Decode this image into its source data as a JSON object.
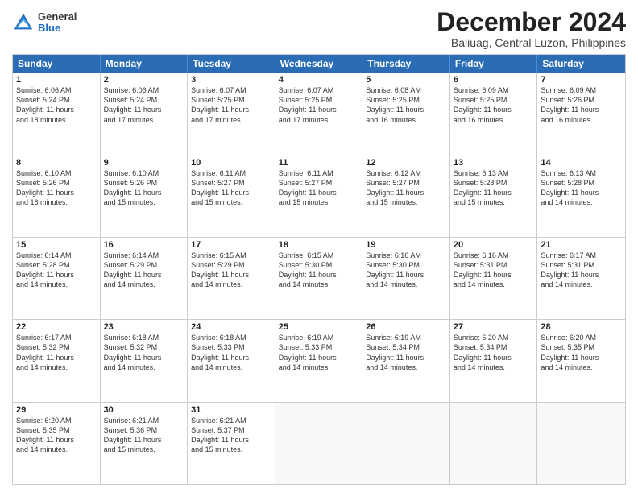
{
  "logo": {
    "general": "General",
    "blue": "Blue"
  },
  "title": {
    "month": "December 2024",
    "location": "Baliuag, Central Luzon, Philippines"
  },
  "header_days": [
    "Sunday",
    "Monday",
    "Tuesday",
    "Wednesday",
    "Thursday",
    "Friday",
    "Saturday"
  ],
  "rows": [
    [
      {
        "day": "1",
        "lines": [
          "Sunrise: 6:06 AM",
          "Sunset: 5:24 PM",
          "Daylight: 11 hours",
          "and 18 minutes."
        ]
      },
      {
        "day": "2",
        "lines": [
          "Sunrise: 6:06 AM",
          "Sunset: 5:24 PM",
          "Daylight: 11 hours",
          "and 17 minutes."
        ]
      },
      {
        "day": "3",
        "lines": [
          "Sunrise: 6:07 AM",
          "Sunset: 5:25 PM",
          "Daylight: 11 hours",
          "and 17 minutes."
        ]
      },
      {
        "day": "4",
        "lines": [
          "Sunrise: 6:07 AM",
          "Sunset: 5:25 PM",
          "Daylight: 11 hours",
          "and 17 minutes."
        ]
      },
      {
        "day": "5",
        "lines": [
          "Sunrise: 6:08 AM",
          "Sunset: 5:25 PM",
          "Daylight: 11 hours",
          "and 16 minutes."
        ]
      },
      {
        "day": "6",
        "lines": [
          "Sunrise: 6:09 AM",
          "Sunset: 5:25 PM",
          "Daylight: 11 hours",
          "and 16 minutes."
        ]
      },
      {
        "day": "7",
        "lines": [
          "Sunrise: 6:09 AM",
          "Sunset: 5:26 PM",
          "Daylight: 11 hours",
          "and 16 minutes."
        ]
      }
    ],
    [
      {
        "day": "8",
        "lines": [
          "Sunrise: 6:10 AM",
          "Sunset: 5:26 PM",
          "Daylight: 11 hours",
          "and 16 minutes."
        ]
      },
      {
        "day": "9",
        "lines": [
          "Sunrise: 6:10 AM",
          "Sunset: 5:26 PM",
          "Daylight: 11 hours",
          "and 15 minutes."
        ]
      },
      {
        "day": "10",
        "lines": [
          "Sunrise: 6:11 AM",
          "Sunset: 5:27 PM",
          "Daylight: 11 hours",
          "and 15 minutes."
        ]
      },
      {
        "day": "11",
        "lines": [
          "Sunrise: 6:11 AM",
          "Sunset: 5:27 PM",
          "Daylight: 11 hours",
          "and 15 minutes."
        ]
      },
      {
        "day": "12",
        "lines": [
          "Sunrise: 6:12 AM",
          "Sunset: 5:27 PM",
          "Daylight: 11 hours",
          "and 15 minutes."
        ]
      },
      {
        "day": "13",
        "lines": [
          "Sunrise: 6:13 AM",
          "Sunset: 5:28 PM",
          "Daylight: 11 hours",
          "and 15 minutes."
        ]
      },
      {
        "day": "14",
        "lines": [
          "Sunrise: 6:13 AM",
          "Sunset: 5:28 PM",
          "Daylight: 11 hours",
          "and 14 minutes."
        ]
      }
    ],
    [
      {
        "day": "15",
        "lines": [
          "Sunrise: 6:14 AM",
          "Sunset: 5:28 PM",
          "Daylight: 11 hours",
          "and 14 minutes."
        ]
      },
      {
        "day": "16",
        "lines": [
          "Sunrise: 6:14 AM",
          "Sunset: 5:29 PM",
          "Daylight: 11 hours",
          "and 14 minutes."
        ]
      },
      {
        "day": "17",
        "lines": [
          "Sunrise: 6:15 AM",
          "Sunset: 5:29 PM",
          "Daylight: 11 hours",
          "and 14 minutes."
        ]
      },
      {
        "day": "18",
        "lines": [
          "Sunrise: 6:15 AM",
          "Sunset: 5:30 PM",
          "Daylight: 11 hours",
          "and 14 minutes."
        ]
      },
      {
        "day": "19",
        "lines": [
          "Sunrise: 6:16 AM",
          "Sunset: 5:30 PM",
          "Daylight: 11 hours",
          "and 14 minutes."
        ]
      },
      {
        "day": "20",
        "lines": [
          "Sunrise: 6:16 AM",
          "Sunset: 5:31 PM",
          "Daylight: 11 hours",
          "and 14 minutes."
        ]
      },
      {
        "day": "21",
        "lines": [
          "Sunrise: 6:17 AM",
          "Sunset: 5:31 PM",
          "Daylight: 11 hours",
          "and 14 minutes."
        ]
      }
    ],
    [
      {
        "day": "22",
        "lines": [
          "Sunrise: 6:17 AM",
          "Sunset: 5:32 PM",
          "Daylight: 11 hours",
          "and 14 minutes."
        ]
      },
      {
        "day": "23",
        "lines": [
          "Sunrise: 6:18 AM",
          "Sunset: 5:32 PM",
          "Daylight: 11 hours",
          "and 14 minutes."
        ]
      },
      {
        "day": "24",
        "lines": [
          "Sunrise: 6:18 AM",
          "Sunset: 5:33 PM",
          "Daylight: 11 hours",
          "and 14 minutes."
        ]
      },
      {
        "day": "25",
        "lines": [
          "Sunrise: 6:19 AM",
          "Sunset: 5:33 PM",
          "Daylight: 11 hours",
          "and 14 minutes."
        ]
      },
      {
        "day": "26",
        "lines": [
          "Sunrise: 6:19 AM",
          "Sunset: 5:34 PM",
          "Daylight: 11 hours",
          "and 14 minutes."
        ]
      },
      {
        "day": "27",
        "lines": [
          "Sunrise: 6:20 AM",
          "Sunset: 5:34 PM",
          "Daylight: 11 hours",
          "and 14 minutes."
        ]
      },
      {
        "day": "28",
        "lines": [
          "Sunrise: 6:20 AM",
          "Sunset: 5:35 PM",
          "Daylight: 11 hours",
          "and 14 minutes."
        ]
      }
    ],
    [
      {
        "day": "29",
        "lines": [
          "Sunrise: 6:20 AM",
          "Sunset: 5:35 PM",
          "Daylight: 11 hours",
          "and 14 minutes."
        ]
      },
      {
        "day": "30",
        "lines": [
          "Sunrise: 6:21 AM",
          "Sunset: 5:36 PM",
          "Daylight: 11 hours",
          "and 15 minutes."
        ]
      },
      {
        "day": "31",
        "lines": [
          "Sunrise: 6:21 AM",
          "Sunset: 5:37 PM",
          "Daylight: 11 hours",
          "and 15 minutes."
        ]
      },
      {
        "day": "",
        "lines": []
      },
      {
        "day": "",
        "lines": []
      },
      {
        "day": "",
        "lines": []
      },
      {
        "day": "",
        "lines": []
      }
    ]
  ]
}
